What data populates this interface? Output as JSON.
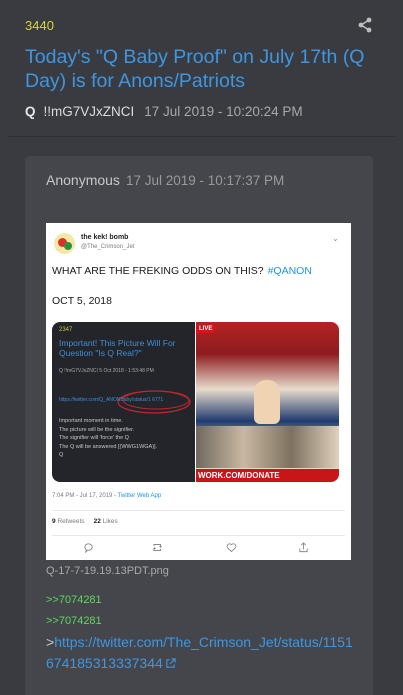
{
  "post": {
    "number": "3440",
    "title": "Today's \"Q Baby Proof\" on July 17th (Q Day) is for Anons/Patriots",
    "author": "Q",
    "tripcode": "!!mG7VJxZNCI",
    "datetime": "17 Jul 2019 - 10:20:24 PM",
    "share_icon": "share-icon"
  },
  "reply": {
    "author": "Anonymous",
    "datetime": "17 Jul 2019 - 10:17:37 PM",
    "attachment_filename": "Q-17-7-19.19.13PDT.png",
    "refs": [
      ">>7074281",
      ">>7074281"
    ],
    "link_prefix": ">",
    "link_url": "https://twitter.com/The_Crimson_Jet/status/1151674185313337344",
    "external_icon": "external-link-icon"
  },
  "tweet": {
    "display_name": "the kek! bomb",
    "handle": "@The_Crimson_Jet",
    "text": "WHAT ARE THE FREKING ODDS ON THIS?",
    "hashtag": "#QANON",
    "date_line": "OCT 5, 2018",
    "timestamp": "7:04 PM - Jul 17, 2019 -",
    "via": "Twitter Web App",
    "retweets_count": "9",
    "retweets_label": "Retweets",
    "likes_count": "22",
    "likes_label": "Likes",
    "embedded_post": {
      "number": "2347",
      "title": "Important! This Picture Will For Question \"Is Q Real?\"",
      "meta": "Q  !!mG7VJxZNCI  5 Oct 2018 - 1:53:48 PM",
      "link": "https://twitter.com/Q_ANONBaby/status/1 6771",
      "body": [
        "Important moment in time.",
        "The picture will be the signifier.",
        "The signifier will 'force' the Q",
        "The Q will be answered [(WWG1WGA)].",
        "Q"
      ]
    },
    "embedded_photo": {
      "badge": "LIVE",
      "banner": "WORK.COM/DONATE"
    },
    "actions": [
      "reply-icon",
      "retweet-icon",
      "like-icon",
      "share-icon"
    ]
  }
}
